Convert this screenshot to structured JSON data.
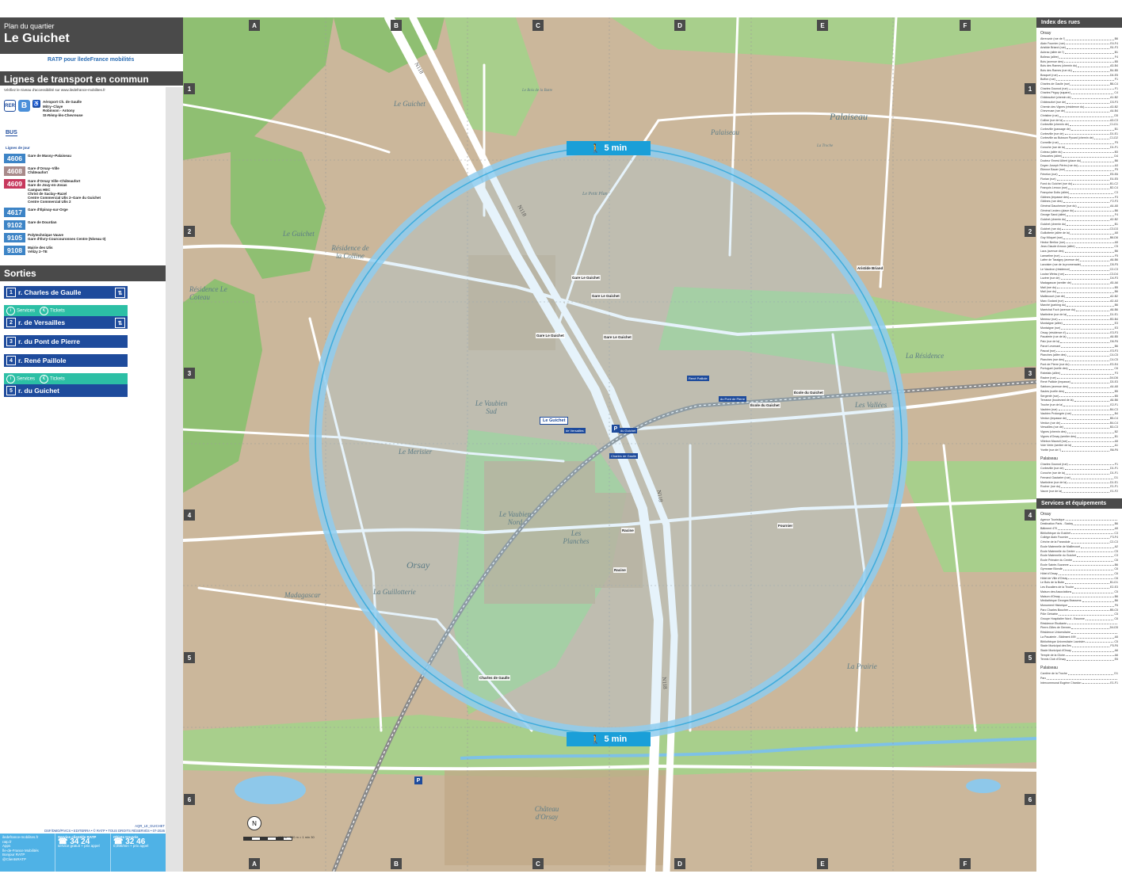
{
  "header": {
    "kicker": "Plan du quartier",
    "title": "Le Guichet",
    "logos": "RATP pour îledeFrance mobilités"
  },
  "transport": {
    "heading": "Lignes de transport en commun",
    "access_note": "Vérifiez le niveau d'accessibilité sur www.iledefrance-mobilites.fr",
    "rer_label": "RER",
    "rer_line": "B",
    "rer_dest_1": "Aéroport Ch. de Gaulle",
    "rer_dest_2": "Mitry–Claye",
    "rer_dest_3": "Robinson - Antony",
    "rer_dest_4": "St-Rémy-lès-Chevreuse",
    "bus_label": "BUS",
    "jour_label": "Lignes de jour",
    "bus_lines": [
      {
        "num": "4606",
        "color": "#3d84c6",
        "dest": "Gare de Massy–Palaiseau"
      },
      {
        "num": "4608",
        "color": "#a88a8a",
        "dest": "Gare d'Orsay–Ville\nChâteaufort"
      },
      {
        "num": "4609",
        "color": "#c7385d",
        "dest": "Gare d'Orsay Ville–Châteaufort\nGare de Jouy-en-Josas\nCampus HEC\nChrist de Saclay–Razel\nCentre Commercial Ulis 2–Gare du Guichet\nCentre Commercial Ulis 2"
      },
      {
        "num": "4617",
        "color": "#3d84c6",
        "dest": "Gare d'Épinay-sur-Orge"
      },
      {
        "num": "9102",
        "color": "#3d84c6",
        "dest": "Gare de Dourdan"
      },
      {
        "num": "9105",
        "color": "#3d84c6",
        "dest": "Polytechnique Vauve\nGare d'Évry-Courcouronnes Centre (Niveau 0)"
      },
      {
        "num": "9108",
        "color": "#3d84c6",
        "dest": "Mairie des Ulis\nVélizy 2–TE"
      }
    ]
  },
  "exits": {
    "heading": "Sorties",
    "services": "Services",
    "tickets": "Tickets",
    "items": [
      {
        "num": "1",
        "label": "r. Charles de Gaulle",
        "services": false,
        "elevator": true
      },
      {
        "num": "2",
        "label": "r. de Versailles",
        "services": true,
        "elevator": true
      },
      {
        "num": "3",
        "label": "r. du Pont de Pierre",
        "services": false,
        "elevator": false
      },
      {
        "num": "4",
        "label": "r. René Paillole",
        "services": false,
        "elevator": false
      },
      {
        "num": "5",
        "label": "r. du Guichet",
        "services": true,
        "elevator": false
      }
    ]
  },
  "footer": {
    "ref": "AQR_LE_GUICHET",
    "credits": "DSF/DMO/PIVCS • EDITERRA • © RATP • TOUS DROITS RÉSERVÉS • 07-2026",
    "web": "iledefrance-mobilites.fr\nratp.fr",
    "apps": "Apps\nÎle-de-France Mobilités\nBonjour RATP",
    "twitter": "@ClientsRATP",
    "service_title": "Service clientèle RATP",
    "service_num": "34 24",
    "service_note": "service gratuit + prix appel",
    "lost_title": "Objets trouvés",
    "lost_num": "32 46",
    "lost_note": "0,05€/min + prix appel"
  },
  "map": {
    "columns": [
      "A",
      "B",
      "C",
      "D",
      "E",
      "F"
    ],
    "rows": [
      "1",
      "2",
      "3",
      "4",
      "5",
      "6"
    ],
    "walk_label": "5 min",
    "places": [
      {
        "name": "Le Guichet"
      },
      {
        "name": "Palaiseau"
      },
      {
        "name": "Palaiseau"
      },
      {
        "name": "Le Guichet"
      },
      {
        "name": "Résidence de la Colline"
      },
      {
        "name": "Résidence Le Coteau"
      },
      {
        "name": "Le Petit Plan"
      },
      {
        "name": "Le Vaubien Sud"
      },
      {
        "name": "Le Merisier"
      },
      {
        "name": "Le Vaubien Nord"
      },
      {
        "name": "Orsay"
      },
      {
        "name": "La Guillotterie"
      },
      {
        "name": "Madagascar"
      },
      {
        "name": "Les Planches"
      },
      {
        "name": "La Résidence"
      },
      {
        "name": "Les Vallées"
      },
      {
        "name": "La Prairie"
      },
      {
        "name": "Château d'Orsay"
      },
      {
        "name": "La Troche"
      },
      {
        "name": "Le Bois de la Butte"
      }
    ],
    "roads": [
      "N118",
      "N118",
      "N118",
      "N118"
    ],
    "station": "Le Guichet",
    "stops": [
      "Gare Le Guichet",
      "Gare Le Guichet",
      "Gare Le Guichet",
      "Gare Le Guichet",
      "Racine",
      "Racine",
      "Charles de Gaulle",
      "Fournier",
      "École du Guichet",
      "École du Guichet",
      "Aristide Briand"
    ],
    "map_exits": [
      {
        "label": "de Versailles"
      },
      {
        "label": "du Guichet"
      },
      {
        "label": "Charles de Gaulle"
      },
      {
        "label": "René Paillole"
      },
      {
        "label": "du Pont de Pierre"
      }
    ],
    "compass": "N",
    "scale": "100 m",
    "scale_note": "100 m = 1 min 30"
  },
  "index": {
    "heading": "Index des rues",
    "town_orsay": "Orsay",
    "streets_orsay": [
      [
        "Abreuvoir (rue de l')",
        "B6"
      ],
      [
        "Alain Fournier (rue)",
        "E4-F4"
      ],
      [
        "Aristide Briand (rue)",
        "B1-F3"
      ],
      [
        "Aubrac (allée de l')",
        "B1"
      ],
      [
        "Boileau (allée)",
        "F4"
      ],
      [
        "Bois (avenue des)",
        "B5"
      ],
      [
        "Bois des Rames (chemin du)",
        "A3-B4"
      ],
      [
        "Bois des Rames (rue du)",
        "B4-B5"
      ],
      [
        "Bosquet (rue)",
        "D4-E5"
      ],
      [
        "Buffon (rue)",
        "F1"
      ],
      [
        "Charles de Gaulle (rue)",
        "B6-C4"
      ],
      [
        "Charles Gounod (rue)",
        "F1"
      ],
      [
        "Charles Péguy (square)",
        "C4"
      ],
      [
        "Châteaufort (chemin de)",
        "A1-B2"
      ],
      [
        "Châteaufort (rue de)",
        "D3-F3"
      ],
      [
        "Chemin des Vignes (résidence du)",
        "A3-B2"
      ],
      [
        "Chevreuse (rue de)",
        "A4-B4"
      ],
      [
        "Christine (rue)",
        "D5"
      ],
      [
        "Colline (rue de la)",
        "A3-C3"
      ],
      [
        "Corbeville (chemin de)",
        "C1-D1"
      ],
      [
        "Corbeville (passage de)",
        "B1"
      ],
      [
        "Corbeville (rue de)",
        "D1-E1"
      ],
      [
        "Corbeville au Buisson Pycard (chemin de)",
        "C1-D2"
      ],
      [
        "Corneille (rue)",
        "F5"
      ],
      [
        "Coroche (rue de la)",
        "D1-F1"
      ],
      [
        "Coteau (allée du)",
        "B3"
      ],
      [
        "Descartes (allée)",
        "D4"
      ],
      [
        "Docteur Ernest Albert (place du)",
        "B6"
      ],
      [
        "Doyen Joseph Pérès (rue du)",
        "A3"
      ],
      [
        "Étienne Bauer (rue)",
        "F5"
      ],
      [
        "Fénelon (rue)",
        "E5-E6"
      ],
      [
        "Florian (rue)",
        "E4-E5"
      ],
      [
        "Fond du Guichet (rue du)",
        "B1-C2"
      ],
      [
        "François Leroux (rue)",
        "B2-C4"
      ],
      [
        "Françoise Dolto (allée)",
        "C3"
      ],
      [
        "Gâtines (impasse des)",
        "F3"
      ],
      [
        "Gâtines (rue des)",
        "F2-F3"
      ],
      [
        "Général Dauchesne (rue du)",
        "A4-A5"
      ],
      [
        "Général Leclerc (place du)",
        "B6"
      ],
      [
        "George Sand (allée)",
        "F4"
      ],
      [
        "Guichet (chemin du)",
        "A2-B2"
      ],
      [
        "Guichet (chemin du)",
        "B1"
      ],
      [
        "Guichet (rue du)",
        "C3-D3"
      ],
      [
        "Guillotterie (allée de la)",
        "A5"
      ],
      [
        "Guy Môquet (rue)",
        "B6-D6"
      ],
      [
        "Hector Berlioz (rue)",
        "A5"
      ],
      [
        "Jean-Claude Arnoux (allée)",
        "C5"
      ],
      [
        "Lacs (avenue des)",
        "B6"
      ],
      [
        "Lamartine (rue)",
        "F5"
      ],
      [
        "Lattre de Tassigny (avenue de)",
        "A6-B6"
      ],
      [
        "Lavoisier (rue de la promenade)",
        "D5-F5"
      ],
      [
        "Le Vaudron (résidence)",
        "C2-C3"
      ],
      [
        "Louise Weiss (rue)",
        "C3-D4"
      ],
      [
        "Lozère (rue de)",
        "D4-F3"
      ],
      [
        "Madagascar (sentier de)",
        "A5-A6"
      ],
      [
        "Mail (rue du)",
        "B5"
      ],
      [
        "Mail (rue du)",
        "B6"
      ],
      [
        "Maillecourt (rue de)",
        "A2-B2"
      ],
      [
        "Marc Godard (rue)",
        "A2-A3"
      ],
      [
        "Marché (parking du)",
        "B6"
      ],
      [
        "Maréchal Foch (avenue du)",
        "A6-B6"
      ],
      [
        "Martinière (rue de la)",
        "D1-E1"
      ],
      [
        "Mermoz (rue)",
        "B3-B4"
      ],
      [
        "Montaigne (allée)",
        "E3"
      ],
      [
        "Montaigne (rue)",
        "E3"
      ],
      [
        "Orsay (résidence d')",
        "E3-F3"
      ],
      [
        "Pacaterie (rue de la)",
        "A6-B5"
      ],
      [
        "Paix (rue de la)",
        "D6-F6"
      ],
      [
        "Parcé Levenant",
        "B6"
      ],
      [
        "Pascal (rue)",
        "E3-F3"
      ],
      [
        "Planches (allée des)",
        "C4-C5"
      ],
      [
        "Planches (rue des)",
        "C4-C5"
      ],
      [
        "Pont de Pierre (rue du)",
        "E3-E4"
      ],
      [
        "Portuguet (ruelle des)",
        "C6"
      ],
      [
        "Rabelais (allée)",
        "F3"
      ],
      [
        "Racine (rue)",
        "D4-D6"
      ],
      [
        "René Paillole (impasse)",
        "D3-E3"
      ],
      [
        "Sablons (avenue des)",
        "A4-A5"
      ],
      [
        "Saules (ruelle des)",
        "B5"
      ],
      [
        "Sergenté (rue)",
        "B5"
      ],
      [
        "Terrasse (boulevard de la)",
        "A6-B6"
      ],
      [
        "Troche (rue de la)",
        "E2-F1"
      ],
      [
        "Vaubien (rue)",
        "B4-C3"
      ],
      [
        "Vaubien Prolongée (rue)",
        "B4"
      ],
      [
        "Verdun (impasse de)",
        "B5-C4"
      ],
      [
        "Verdun (rue de)",
        "B4-C4"
      ],
      [
        "Versailles (rue de)",
        "B3-C3"
      ],
      [
        "Vignes (chemin des)",
        "B2"
      ],
      [
        "Vignes d'Orsay (sentier des)",
        "B1"
      ],
      [
        "Villebon Mauroll (rue)",
        "A5"
      ],
      [
        "Voie Verte (sentier de la)",
        "A1"
      ],
      [
        "Yvette (rue de l')",
        "B6-F6"
      ]
    ],
    "town_palaiseau": "Palaiseau",
    "streets_palaiseau": [
      [
        "Charles Gounod (rue)",
        "F1"
      ],
      [
        "Corbeville (rue de)",
        "D1-F1"
      ],
      [
        "Coroche (rue de la)",
        "D1-F1"
      ],
      [
        "Fernand Gautarier (rue)",
        "D1"
      ],
      [
        "Martinière (rue de la)",
        "D1-E1"
      ],
      [
        "Rocher (rue du)",
        "E1-F1"
      ],
      [
        "Vauve (rue de la)",
        "E1-F2"
      ]
    ],
    "services_heading": "Services et équipements",
    "services_orsay": [
      [
        "Agence Touristique",
        ""
      ],
      [
        "Destination Paris - Saclay",
        "B6"
      ],
      [
        "Bâtiment 470",
        "A5"
      ],
      [
        "Bibliothèque du Guichet",
        "C3"
      ],
      [
        "Collège Alain Fournier",
        "F3-F4"
      ],
      [
        "Crèche de la Farandole",
        "C2-C3"
      ],
      [
        "École Maternelle de Maillecourt",
        "A2"
      ],
      [
        "École Maternelle du Centre",
        "C5"
      ],
      [
        "École Maternelle du Guichet",
        "C3"
      ],
      [
        "École Primaire du Centre",
        "C6"
      ],
      [
        "École Sainte-Suzanne",
        "B6"
      ],
      [
        "Gymnase Blondin",
        "C6"
      ],
      [
        "Hôtel d'Orsay",
        "C6"
      ],
      [
        "Hôtel de Ville d'Orsay",
        "C6"
      ],
      [
        "Le Bois de la Butte",
        "B1-D1"
      ],
      [
        "Les Escaliers de la Troche",
        "E2-E3"
      ],
      [
        "Maison des Associations",
        "C5"
      ],
      [
        "Maison d'Orsay",
        "B6"
      ],
      [
        "Médiathèque Georges Brassens",
        "B6"
      ],
      [
        "Monument Historique",
        "F6"
      ],
      [
        "Parc Charles Boucher",
        "B5-C5"
      ],
      [
        "Pôle Gériatrie",
        "C5"
      ],
      [
        "Groupe Hospitalier Nord - Essonne",
        "C6"
      ],
      [
        "Résidence Étudiante",
        ""
      ],
      [
        "Pierre-Gilles de Gennes",
        "D4-D5"
      ],
      [
        "Résidence Universitaire",
        ""
      ],
      [
        "La Pacaterie - Bâtiment 499",
        "A5"
      ],
      [
        "Bibliothèque Universitaire Lavoisier",
        "C5"
      ],
      [
        "Stade Municipal des Îles",
        "F5-F6"
      ],
      [
        "Stade Municipal d'Orsay",
        "A6"
      ],
      [
        "Temple de la Gloire",
        "A6"
      ],
      [
        "Tennis Club d'Orsay",
        "E6"
      ]
    ],
    "services_town_palaiseau": "Palaiseau",
    "services_palaiseau": [
      [
        "Carrière de la Troche",
        "D1"
      ],
      [
        "Parc",
        ""
      ],
      [
        "Intercommunal Eugène Chanlon",
        "E1-F1"
      ]
    ]
  }
}
